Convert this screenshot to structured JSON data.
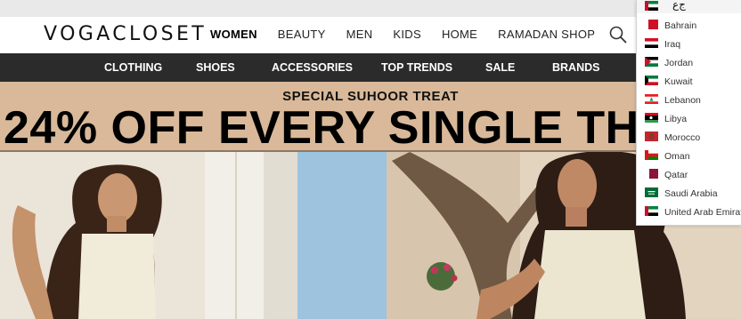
{
  "brand": {
    "name": "VOGACLOSET"
  },
  "main_nav": [
    "WOMEN",
    "BEAUTY",
    "MEN",
    "KIDS",
    "HOME",
    "RAMADAN SHOP"
  ],
  "sub_nav": [
    "CLOTHING",
    "SHOES",
    "ACCESSORIES",
    "TOP TRENDS",
    "SALE",
    "BRANDS"
  ],
  "banner": {
    "subtitle": "SPECIAL SUHOOR TREAT",
    "headline": "24% OFF EVERY SINGLE TH"
  },
  "country_dropdown": {
    "selected_label": "ﺝﻉ",
    "options": [
      "Bahrain",
      "Iraq",
      "Jordan",
      "Kuwait",
      "Lebanon",
      "Libya",
      "Morocco",
      "Oman",
      "Qatar",
      "Saudi Arabia",
      "United Arab Emirat"
    ]
  },
  "colors": {
    "subnav_bg": "#2b2b2b",
    "banner_bg": "#d9b99a",
    "sky": "#9dc3df"
  },
  "icons": [
    "search-icon"
  ]
}
